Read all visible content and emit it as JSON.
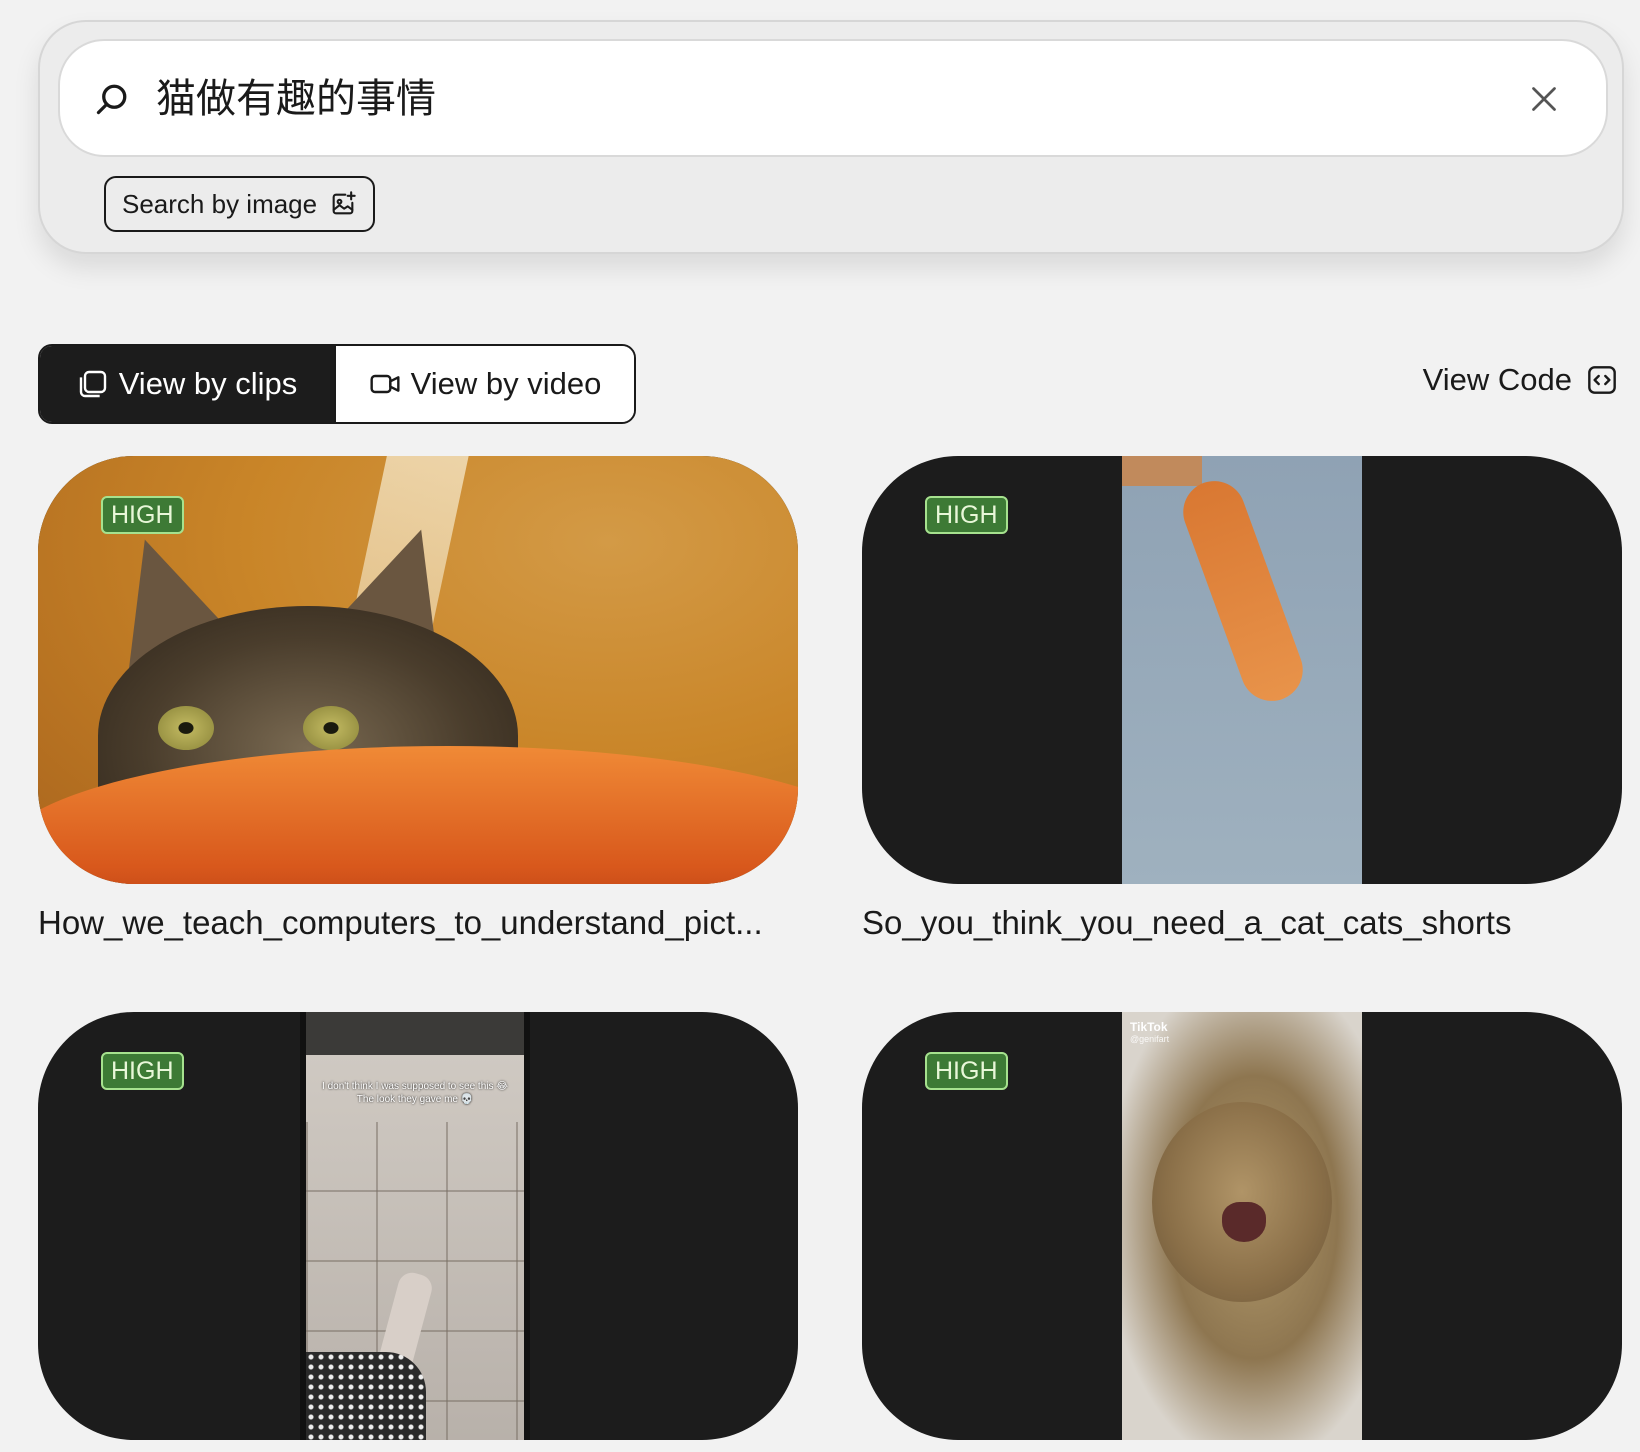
{
  "search": {
    "query": "猫做有趣的事情",
    "image_search_label": "Search by image"
  },
  "view_toggle": {
    "clips_label": "View by clips",
    "video_label": "View by video",
    "active": "clips"
  },
  "view_code_label": "View Code",
  "results": [
    {
      "confidence": "HIGH",
      "title": "How_we_teach_computers_to_understand_pict..."
    },
    {
      "confidence": "HIGH",
      "title": "So_you_think_you_need_a_cat_cats_shorts"
    },
    {
      "confidence": "HIGH",
      "title": "",
      "overlay_text": "I don't think I was supposed to see this 😂 The look they gave me 💀"
    },
    {
      "confidence": "HIGH",
      "title": "",
      "watermark": "TikTok",
      "watermark_handle": "@genifart"
    }
  ],
  "colors": {
    "badge_bg": "#3d7a35",
    "badge_border": "#a6e28e",
    "active_tab_bg": "#1c1c1c",
    "card_bg": "#1c1c1c"
  }
}
